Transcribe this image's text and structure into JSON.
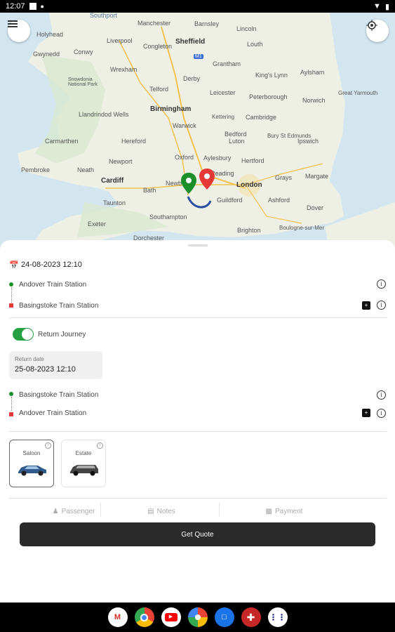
{
  "status_bar": {
    "time": "12:07"
  },
  "map": {
    "places": [
      {
        "name": "Southport",
        "cls": ""
      },
      {
        "name": "Manchester",
        "cls": ""
      },
      {
        "name": "Barnsley",
        "cls": ""
      },
      {
        "name": "Holyhead",
        "cls": ""
      },
      {
        "name": "Liverpool",
        "cls": ""
      },
      {
        "name": "Sheffield",
        "cls": "big"
      },
      {
        "name": "Lincoln",
        "cls": ""
      },
      {
        "name": "Louth",
        "cls": ""
      },
      {
        "name": "Conwy",
        "cls": ""
      },
      {
        "name": "Gwynedd",
        "cls": ""
      },
      {
        "name": "Congleton",
        "cls": ""
      },
      {
        "name": "Wrexham",
        "cls": ""
      },
      {
        "name": "Snowdonia National Park",
        "cls": ""
      },
      {
        "name": "Grantham",
        "cls": ""
      },
      {
        "name": "King's Lynn",
        "cls": ""
      },
      {
        "name": "Aylsham",
        "cls": ""
      },
      {
        "name": "Derby",
        "cls": ""
      },
      {
        "name": "Telford",
        "cls": ""
      },
      {
        "name": "Leicester",
        "cls": ""
      },
      {
        "name": "Peterborough",
        "cls": ""
      },
      {
        "name": "Norwich",
        "cls": ""
      },
      {
        "name": "Great Yarmouth",
        "cls": ""
      },
      {
        "name": "Birmingham",
        "cls": "big"
      },
      {
        "name": "Llandrindod Wells",
        "cls": ""
      },
      {
        "name": "Warwick",
        "cls": ""
      },
      {
        "name": "Kettering",
        "cls": ""
      },
      {
        "name": "Cambridge",
        "cls": ""
      },
      {
        "name": "Bedford",
        "cls": ""
      },
      {
        "name": "Bury St Edmunds",
        "cls": ""
      },
      {
        "name": "Carmarthen",
        "cls": ""
      },
      {
        "name": "Hereford",
        "cls": ""
      },
      {
        "name": "Luton",
        "cls": ""
      },
      {
        "name": "Ipswich",
        "cls": ""
      },
      {
        "name": "Oxford",
        "cls": ""
      },
      {
        "name": "Aylesbury",
        "cls": ""
      },
      {
        "name": "Hertford",
        "cls": ""
      },
      {
        "name": "Pembroke",
        "cls": ""
      },
      {
        "name": "Neath",
        "cls": ""
      },
      {
        "name": "Newport",
        "cls": ""
      },
      {
        "name": "Cardiff",
        "cls": "big"
      },
      {
        "name": "London",
        "cls": "big"
      },
      {
        "name": "Grays",
        "cls": ""
      },
      {
        "name": "Margate",
        "cls": ""
      },
      {
        "name": "Bath",
        "cls": ""
      },
      {
        "name": "Newbury",
        "cls": ""
      },
      {
        "name": "Reading",
        "cls": ""
      },
      {
        "name": "Dover",
        "cls": ""
      },
      {
        "name": "Ashford",
        "cls": ""
      },
      {
        "name": "Guildford",
        "cls": ""
      },
      {
        "name": "Taunton",
        "cls": ""
      },
      {
        "name": "Southampton",
        "cls": ""
      },
      {
        "name": "Brighton",
        "cls": ""
      },
      {
        "name": "Exeter",
        "cls": ""
      },
      {
        "name": "Dorchester",
        "cls": ""
      },
      {
        "name": "Boulogne-sur-Mer",
        "cls": ""
      }
    ],
    "motorway_badge": "M1"
  },
  "booking": {
    "date": "24-08-2023 12:10",
    "pickup": "Andover Train Station",
    "dropoff": "Basingstoke Train Station",
    "return_label": "Return Journey",
    "return_date_label": "Return date",
    "return_date": "25-08-2023 12:10",
    "return_pickup": "Basingstoke Train Station",
    "return_dropoff": "Andover Train Station",
    "vehicles": [
      {
        "name": "Saloon",
        "color": "#2f5a8a"
      },
      {
        "name": "Estate",
        "color": "#444444"
      }
    ],
    "tabs": [
      {
        "label": "Passenger",
        "icon": "people-icon"
      },
      {
        "label": "Notes",
        "icon": "notes-icon"
      },
      {
        "label": "Payment",
        "icon": "payment-icon"
      }
    ],
    "quote_button": "Get Quote"
  },
  "nav_apps": [
    "Gmail",
    "Chrome",
    "YouTube",
    "Photos",
    "Messages",
    "Flag app",
    "All apps"
  ],
  "colors": {
    "pickup": "#1b8f2a",
    "dropoff": "#e53935",
    "toggle": "#27a044",
    "button": "#2b2b2b"
  }
}
